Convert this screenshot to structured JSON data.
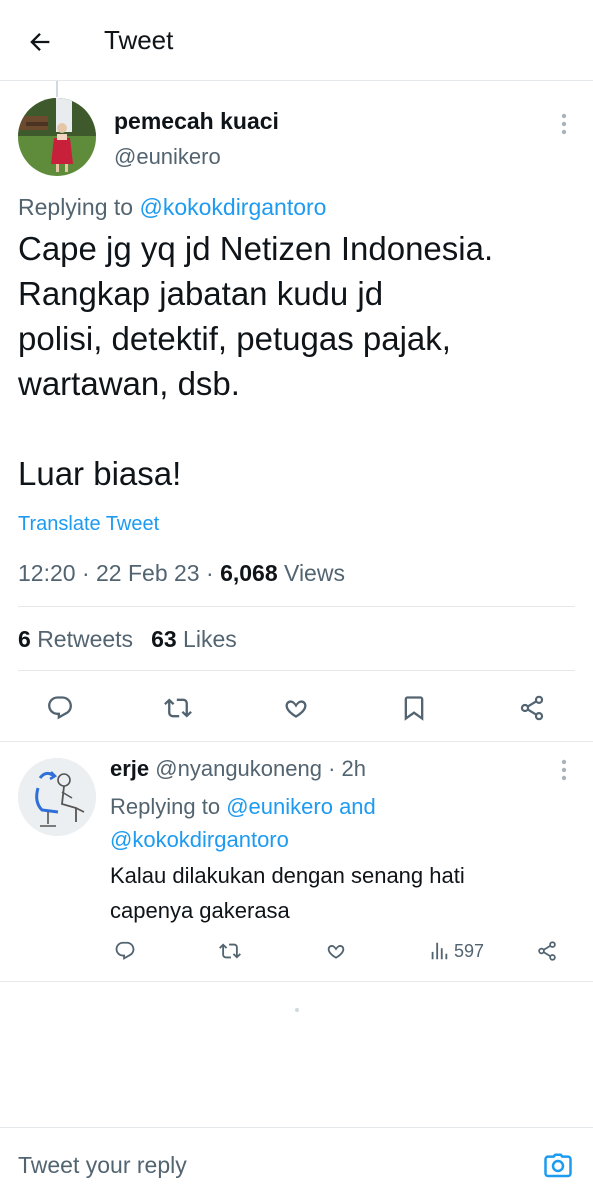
{
  "header": {
    "title": "Tweet",
    "back_icon": "arrow-left-icon"
  },
  "tweet": {
    "author_name": "pemecah kuaci",
    "author_handle": "@eunikero",
    "replying_prefix": "Replying to",
    "replying_to": "@kokokdirgantoro",
    "text": "Cape jg yq jd Netizen Indonesia.\nRangkap jabatan kudu jd\npolisi, detektif, petugas pajak,\nwartawan, dsb.\n\nLuar biasa!",
    "translate_label": "Translate Tweet",
    "time": "12:20",
    "date": "22 Feb 23",
    "views_count": "6,068",
    "views_label": "Views",
    "retweets_count": "6",
    "retweets_label": "Retweets",
    "likes_count": "63",
    "likes_label": "Likes",
    "separator": "·"
  },
  "reply": {
    "author_name": "erje",
    "author_handle": "@nyangukoneng",
    "time_ago": "2h",
    "separator": "·",
    "replying_prefix": "Replying to",
    "replying_user_1": "@eunikero",
    "replying_and": "and",
    "replying_user_2": "@kokokdirgantoro",
    "text": "Kalau dilakukan dengan senang hati capenya gakerasa",
    "views_count": "597"
  },
  "composer": {
    "placeholder": "Tweet your reply",
    "camera_icon": "camera-icon"
  },
  "colors": {
    "accent": "#1d9bf0",
    "text": "#0f1419",
    "secondary": "#536471",
    "divider": "#e6e9eb"
  }
}
